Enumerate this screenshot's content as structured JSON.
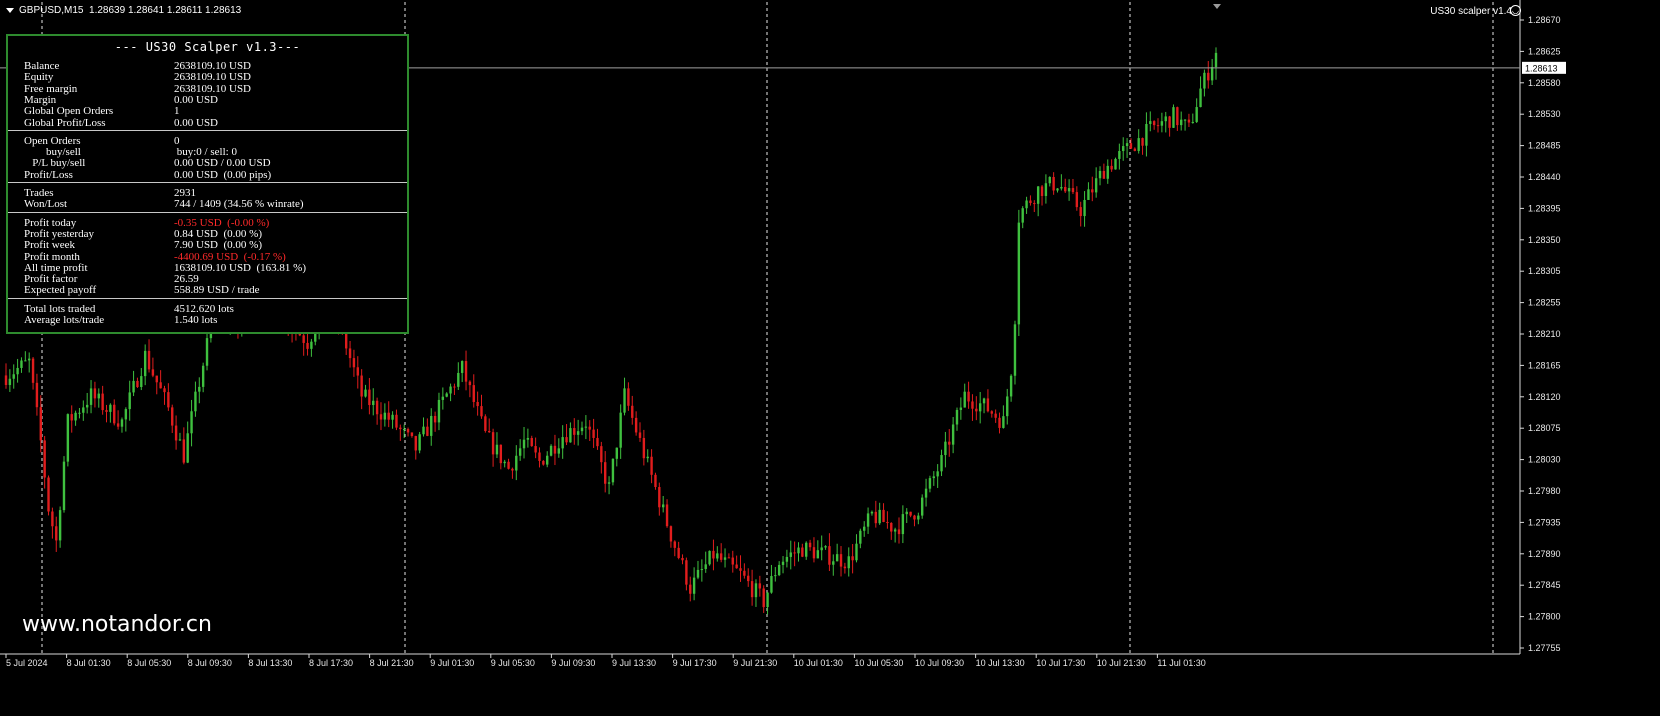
{
  "header": {
    "symbol_info": "GBPUSD,M15  1.28639 1.28641 1.28611 1.28613",
    "ea_label": "US30 scalper v1.4",
    "smiley_icon": "smiley-icon",
    "menu_icon": "dropdown-triangle-icon"
  },
  "panel": {
    "title": "--- US30 Scalper v1.3---",
    "sections": [
      [
        {
          "label": "Balance",
          "value": "2638109.10 USD"
        },
        {
          "label": "Equity",
          "value": "2638109.10 USD"
        },
        {
          "label": "Free margin",
          "value": "2638109.10 USD"
        },
        {
          "label": "Margin",
          "value": "0.00 USD"
        },
        {
          "label": "Global Open Orders",
          "value": "1"
        },
        {
          "label": "Global Profit/Loss",
          "value": "0.00 USD"
        }
      ],
      [
        {
          "label": "Open Orders",
          "value": "0"
        },
        {
          "label": "        buy/sell",
          "value": " buy:0 / sell: 0"
        },
        {
          "label": "   P/L buy/sell",
          "value": "0.00 USD / 0.00 USD"
        },
        {
          "label": "Profit/Loss",
          "value": "0.00 USD  (0.00 pips)"
        }
      ],
      [
        {
          "label": "Trades",
          "value": "2931"
        },
        {
          "label": "Won/Lost",
          "value": "744 / 1409 (34.56 % winrate)"
        }
      ],
      [
        {
          "label": "Profit today",
          "value": "-0.35 USD  (-0.00 %)",
          "color": "#ff2a2a"
        },
        {
          "label": "Profit yesterday",
          "value": "0.84 USD  (0.00 %)"
        },
        {
          "label": "Profit week",
          "value": "7.90 USD  (0.00 %)"
        },
        {
          "label": "Profit month",
          "value": "-4400.69 USD  (-0.17 %)",
          "color": "#ff2a2a"
        },
        {
          "label": "All time profit",
          "value": "1638109.10 USD  (163.81 %)"
        },
        {
          "label": "Profit factor",
          "value": "26.59"
        },
        {
          "label": "Expected payoff",
          "value": "558.89 USD / trade"
        }
      ],
      [
        {
          "label": "Total lots traded",
          "value": "4512.620 lots"
        },
        {
          "label": "Average lots/trade",
          "value": "1.540 lots"
        }
      ]
    ]
  },
  "watermark": "www.notandor.cn",
  "current_price_label": "1.28613",
  "colors": {
    "bull": "#3fc03f",
    "bear": "#e11d1d",
    "panel_border": "#2e8b2e",
    "grid": "#d0d0d0"
  },
  "chart_data": {
    "type": "candlestick",
    "symbol": "GBPUSD",
    "timeframe": "M15",
    "ylim": [
      1.27745,
      1.28685
    ],
    "y_ticks": [
      "1.28670",
      "1.28625",
      "1.28580",
      "1.28530",
      "1.28485",
      "1.28440",
      "1.28395",
      "1.28350",
      "1.28305",
      "1.28255",
      "1.28210",
      "1.28165",
      "1.28120",
      "1.28075",
      "1.28030",
      "1.27980",
      "1.27935",
      "1.27890",
      "1.27845",
      "1.27800",
      "1.27755"
    ],
    "x_ticks": [
      "5 Jul 2024",
      "8 Jul 01:30",
      "8 Jul 05:30",
      "8 Jul 09:30",
      "8 Jul 13:30",
      "8 Jul 17:30",
      "8 Jul 21:30",
      "9 Jul 01:30",
      "9 Jul 05:30",
      "9 Jul 09:30",
      "9 Jul 13:30",
      "9 Jul 17:30",
      "9 Jul 21:30",
      "10 Jul 01:30",
      "10 Jul 05:30",
      "10 Jul 09:30",
      "10 Jul 13:30",
      "10 Jul 17:30",
      "10 Jul 21:30",
      "11 Jul 01:30"
    ],
    "day_separators": [
      "8 Jul",
      "9 Jul",
      "10 Jul",
      "11 Jul"
    ],
    "current_price": 1.28613,
    "anchors": [
      {
        "i": 0,
        "price": 1.2815
      },
      {
        "i": 6,
        "price": 1.2817
      },
      {
        "i": 9,
        "price": 1.2805
      },
      {
        "i": 11,
        "price": 1.2795
      },
      {
        "i": 13,
        "price": 1.279
      },
      {
        "i": 16,
        "price": 1.2808
      },
      {
        "i": 22,
        "price": 1.2812
      },
      {
        "i": 30,
        "price": 1.2808
      },
      {
        "i": 36,
        "price": 1.2818
      },
      {
        "i": 42,
        "price": 1.281
      },
      {
        "i": 46,
        "price": 1.2803
      },
      {
        "i": 54,
        "price": 1.2825
      },
      {
        "i": 60,
        "price": 1.2822
      },
      {
        "i": 66,
        "price": 1.2832
      },
      {
        "i": 72,
        "price": 1.2824
      },
      {
        "i": 78,
        "price": 1.282
      },
      {
        "i": 84,
        "price": 1.2827
      },
      {
        "i": 92,
        "price": 1.2812
      },
      {
        "i": 100,
        "price": 1.2808
      },
      {
        "i": 106,
        "price": 1.2804
      },
      {
        "i": 112,
        "price": 1.281
      },
      {
        "i": 118,
        "price": 1.2816
      },
      {
        "i": 124,
        "price": 1.2806
      },
      {
        "i": 130,
        "price": 1.2801
      },
      {
        "i": 134,
        "price": 1.2805
      },
      {
        "i": 138,
        "price": 1.2802
      },
      {
        "i": 144,
        "price": 1.2806
      },
      {
        "i": 150,
        "price": 1.2808
      },
      {
        "i": 156,
        "price": 1.2798
      },
      {
        "i": 160,
        "price": 1.2812
      },
      {
        "i": 164,
        "price": 1.2805
      },
      {
        "i": 168,
        "price": 1.2798
      },
      {
        "i": 172,
        "price": 1.2791
      },
      {
        "i": 177,
        "price": 1.2783
      },
      {
        "i": 183,
        "price": 1.2788
      },
      {
        "i": 190,
        "price": 1.2785
      },
      {
        "i": 196,
        "price": 1.2781
      },
      {
        "i": 200,
        "price": 1.2787
      },
      {
        "i": 206,
        "price": 1.2789
      },
      {
        "i": 212,
        "price": 1.2788
      },
      {
        "i": 218,
        "price": 1.2787
      },
      {
        "i": 224,
        "price": 1.2794
      },
      {
        "i": 230,
        "price": 1.2792
      },
      {
        "i": 236,
        "price": 1.2795
      },
      {
        "i": 242,
        "price": 1.2802
      },
      {
        "i": 248,
        "price": 1.2812
      },
      {
        "i": 254,
        "price": 1.281
      },
      {
        "i": 258,
        "price": 1.2808
      },
      {
        "i": 260,
        "price": 1.2816
      },
      {
        "i": 263,
        "price": 1.284
      },
      {
        "i": 267,
        "price": 1.2843
      },
      {
        "i": 272,
        "price": 1.2844
      },
      {
        "i": 278,
        "price": 1.284
      },
      {
        "i": 284,
        "price": 1.2846
      },
      {
        "i": 290,
        "price": 1.2849
      },
      {
        "i": 296,
        "price": 1.2852
      },
      {
        "i": 302,
        "price": 1.2854
      },
      {
        "i": 306,
        "price": 1.2852
      },
      {
        "i": 309,
        "price": 1.2858
      },
      {
        "i": 313,
        "price": 1.28635
      }
    ],
    "candle_count": 314
  }
}
